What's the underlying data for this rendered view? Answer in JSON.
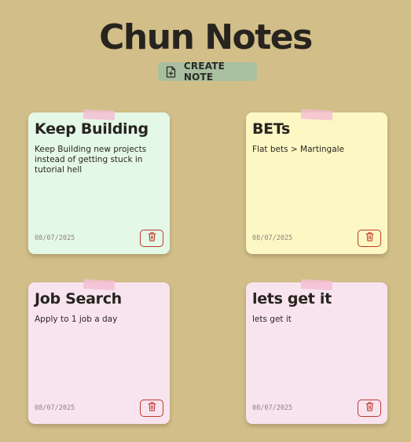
{
  "app": {
    "title": "Chun Notes",
    "create_label": "CREATE NOTE"
  },
  "icons": {
    "create": "file-plus-icon",
    "delete": "trash-icon"
  },
  "colors": {
    "background": "#d2be88",
    "create_button": "#a9bf9f",
    "delete_accent": "#c0392b",
    "tape": "#f4bed4"
  },
  "notes": [
    {
      "title": "Keep Building",
      "body": "Keep Building new projects instead of getting stuck in tutorial hell",
      "date": "08/07/2025",
      "color": "#e4f8e7"
    },
    {
      "title": "BETs",
      "body": "Flat bets > Martingale",
      "date": "08/07/2025",
      "color": "#fdf7c4"
    },
    {
      "title": "Job Search",
      "body": "Apply to 1 job a day",
      "date": "08/07/2025",
      "color": "#f8e4ef"
    },
    {
      "title": "lets get it",
      "body": "lets get it",
      "date": "08/07/2025",
      "color": "#f8e4ef"
    }
  ]
}
